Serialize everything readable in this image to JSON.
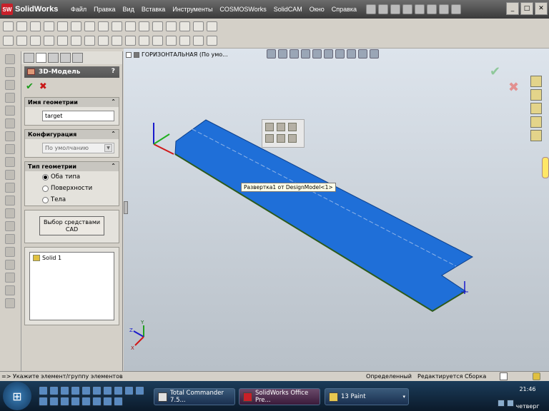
{
  "app": {
    "title": "SolidWorks",
    "logo_glyph": "SW"
  },
  "menu": [
    "Файл",
    "Правка",
    "Вид",
    "Вставка",
    "Инструменты",
    "COSMOSWorks",
    "SolidCAM",
    "Окно",
    "Справка"
  ],
  "window_controls": {
    "minimize": "_",
    "maximize": "□",
    "close": "✕"
  },
  "panel": {
    "title": "3D-Модель",
    "help": "?",
    "ok_glyph": "✔",
    "cancel_glyph": "✖",
    "geometry_name": {
      "label": "Имя геометрии",
      "value": "target"
    },
    "configuration": {
      "label": "Конфигурация",
      "value": "По умолчанию"
    },
    "geometry_type": {
      "label": "Тип геометрии",
      "options": [
        "Оба типа",
        "Поверхности",
        "Тела"
      ],
      "selected": 0
    },
    "cad_button": "Выбор средствами CAD",
    "list": [
      "Solid 1"
    ],
    "chevron": "⌃"
  },
  "graphics": {
    "view_label": "ГОРИЗОНТАЛЬНАЯ  (По умо...",
    "tooltip": "Развертка1 от DesignModel<1>",
    "body_color": "#1f6fd8",
    "confirm_glyph": "✔",
    "cancel_glyph": "✖",
    "triad": {
      "x": "X",
      "y": "Y",
      "z": "Z"
    }
  },
  "status": {
    "prompt": "=> Укажите элемент/группу элементов",
    "defined": "Определенный",
    "editing": "Редактируется Сборка"
  },
  "taskbar": {
    "start_glyph": "⊞",
    "tasks": [
      "Total Commander 7.5...",
      "SolidWorks Office Pre...",
      "13 Paint"
    ],
    "paint_arrow": "▾",
    "clock": "21:46",
    "day": "четверг"
  }
}
